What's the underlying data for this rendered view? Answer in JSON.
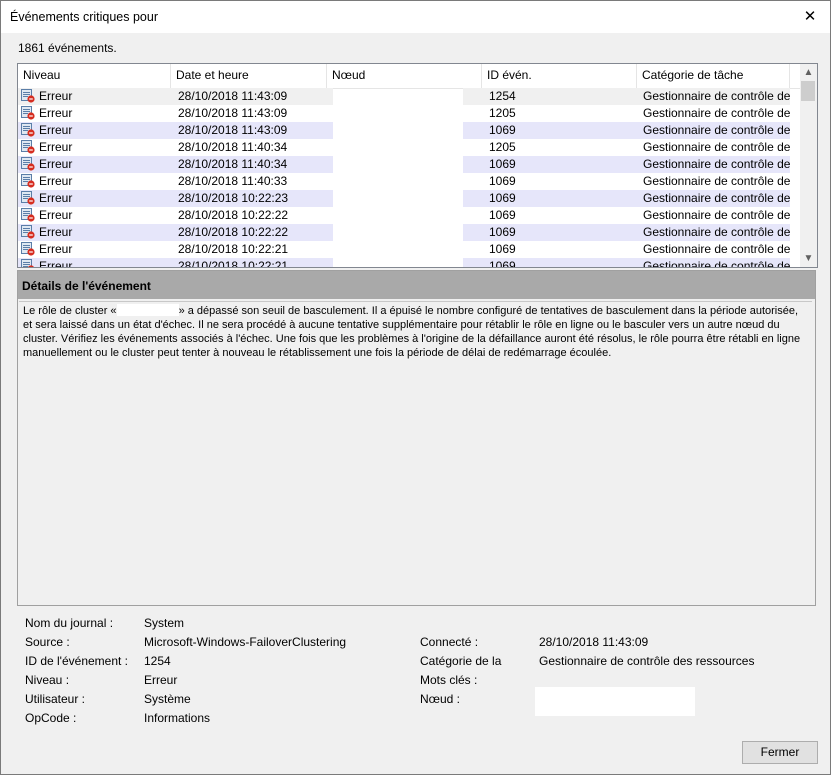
{
  "window": {
    "title": "Événements critiques pour",
    "close_glyph": "✕"
  },
  "event_count": "1861 événements.",
  "grid": {
    "columns": [
      "Niveau",
      "Date et heure",
      "Nœud",
      "ID évén.",
      "Catégorie de tâche"
    ],
    "rows": [
      {
        "level": "Erreur",
        "date": "28/10/2018 11:43:09",
        "node": "",
        "id": "1254",
        "category": "Gestionnaire de contrôle de..."
      },
      {
        "level": "Erreur",
        "date": "28/10/2018 11:43:09",
        "node": "",
        "id": "1205",
        "category": "Gestionnaire de contrôle de..."
      },
      {
        "level": "Erreur",
        "date": "28/10/2018 11:43:09",
        "node": "",
        "id": "1069",
        "category": "Gestionnaire de contrôle de..."
      },
      {
        "level": "Erreur",
        "date": "28/10/2018 11:40:34",
        "node": "",
        "id": "1205",
        "category": "Gestionnaire de contrôle de..."
      },
      {
        "level": "Erreur",
        "date": "28/10/2018 11:40:34",
        "node": "",
        "id": "1069",
        "category": "Gestionnaire de contrôle de..."
      },
      {
        "level": "Erreur",
        "date": "28/10/2018 11:40:33",
        "node": "",
        "id": "1069",
        "category": "Gestionnaire de contrôle de..."
      },
      {
        "level": "Erreur",
        "date": "28/10/2018 10:22:23",
        "node": "",
        "id": "1069",
        "category": "Gestionnaire de contrôle de..."
      },
      {
        "level": "Erreur",
        "date": "28/10/2018 10:22:22",
        "node": "",
        "id": "1069",
        "category": "Gestionnaire de contrôle de..."
      },
      {
        "level": "Erreur",
        "date": "28/10/2018 10:22:22",
        "node": "",
        "id": "1069",
        "category": "Gestionnaire de contrôle de..."
      },
      {
        "level": "Erreur",
        "date": "28/10/2018 10:22:21",
        "node": "",
        "id": "1069",
        "category": "Gestionnaire de contrôle de..."
      },
      {
        "level": "Erreur",
        "date": "28/10/2018 10:22:21",
        "node": "",
        "id": "1069",
        "category": "Gestionnaire de contrôle de..."
      }
    ],
    "level_icon": "error-event-icon"
  },
  "details": {
    "title": "Détails de l'événement",
    "text_before": "Le rôle de cluster «",
    "text_after": "» a dépassé son seuil de basculement. Il a épuisé le nombre configuré de tentatives de basculement dans la période autorisée, et sera laissé dans un état d'échec. Il ne sera procédé à aucune tentative supplémentaire pour rétablir le rôle en ligne ou le basculer vers un autre nœud du cluster. Vérifiez les événements associés à l'échec. Une fois que les problèmes à l'origine de la défaillance auront été résolus, le rôle pourra être rétabli en ligne manuellement ou le cluster peut tenter à nouveau le rétablissement une fois la période de délai de redémarrage écoulée."
  },
  "properties": {
    "log_name_label": "Nom du journal :",
    "log_name": "System",
    "source_label": "Source :",
    "source": "Microsoft-Windows-FailoverClustering",
    "event_id_label": "ID de l'événement :",
    "event_id": "1254",
    "level_label": "Niveau :",
    "level": "Erreur",
    "user_label": "Utilisateur :",
    "user": "Système",
    "opcode_label": "OpCode :",
    "opcode": "Informations",
    "logged_label": "Connecté :",
    "logged": "28/10/2018 11:43:09",
    "task_category_label": "Catégorie de la",
    "task_category": "Gestionnaire de contrôle des ressources",
    "keywords_label": "Mots clés :",
    "keywords": "",
    "node_label": "Nœud :",
    "node": ""
  },
  "close_button": "Fermer"
}
